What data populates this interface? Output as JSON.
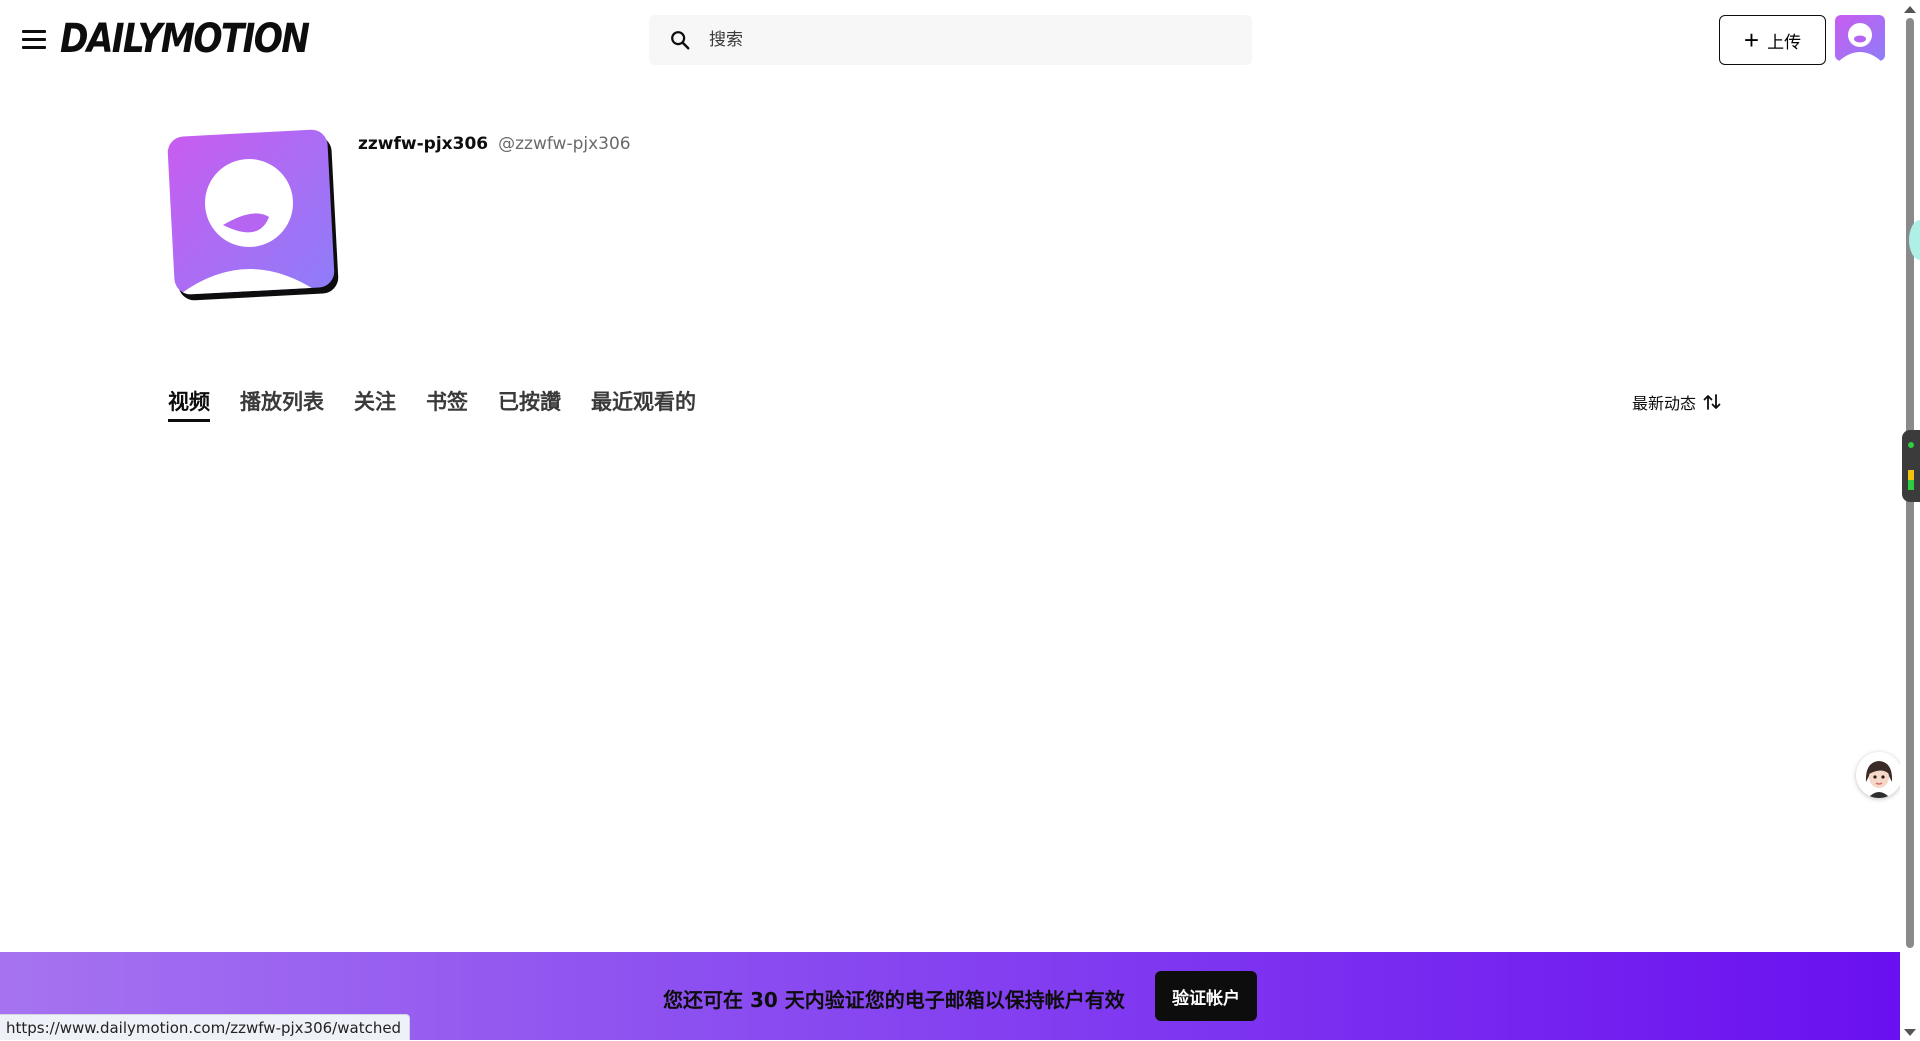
{
  "header": {
    "logo": "DAILYMOTION",
    "search_placeholder": "搜索",
    "upload_label": "上传"
  },
  "profile": {
    "display_name": "zzwfw-pjx306",
    "handle": "@zzwfw-pjx306"
  },
  "tabs": [
    {
      "label": "视频",
      "active": true
    },
    {
      "label": "播放列表",
      "active": false
    },
    {
      "label": "关注",
      "active": false
    },
    {
      "label": "书签",
      "active": false
    },
    {
      "label": "已按讚",
      "active": false
    },
    {
      "label": "最近观看的",
      "active": false
    }
  ],
  "sort": {
    "label": "最新动态"
  },
  "banner": {
    "message": "您还可在 30 天内验证您的电子邮箱以保持帐户有效",
    "button_label": "验证帐户"
  },
  "status_bar": {
    "url": "https://www.dailymotion.com/zzwfw-pjx306/watched"
  },
  "colors": {
    "banner_start": "#a673f0",
    "banner_end": "#6a10f0",
    "avatar_gradient_start": "#c85cf0",
    "avatar_gradient_end": "#8e7df8"
  }
}
